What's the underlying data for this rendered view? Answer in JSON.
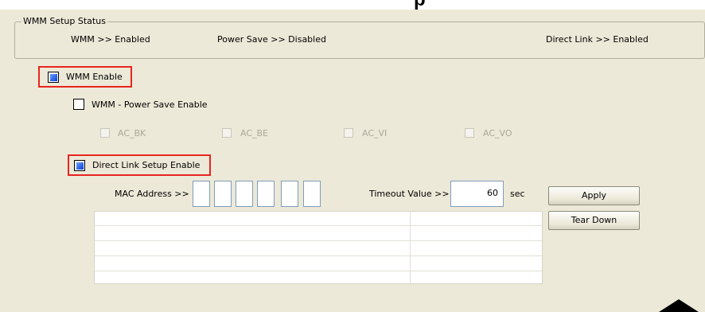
{
  "header_fragment": "p",
  "wmm_status": {
    "title": "WMM Setup Status",
    "wmm": "WMM >> Enabled",
    "power_save": "Power Save >> Disabled",
    "direct_link": "Direct Link >> Enabled"
  },
  "wmm_enable": {
    "label": "WMM Enable",
    "checked": true
  },
  "power_save_enable": {
    "label": "WMM - Power Save Enable",
    "checked": false
  },
  "ac": [
    {
      "label": "AC_BK",
      "checked": false,
      "disabled": true
    },
    {
      "label": "AC_BE",
      "checked": false,
      "disabled": true
    },
    {
      "label": "AC_VI",
      "checked": false,
      "disabled": true
    },
    {
      "label": "AC_VO",
      "checked": false,
      "disabled": true
    }
  ],
  "direct_link_enable": {
    "label": "Direct Link Setup Enable",
    "checked": true
  },
  "mac_address": {
    "label": "MAC Address >>",
    "octets": [
      "",
      "",
      "",
      "",
      "",
      ""
    ]
  },
  "timeout": {
    "label": "Timeout Value >>",
    "value": "60",
    "unit": "sec"
  },
  "buttons": {
    "apply": "Apply",
    "tear_down": "Tear Down"
  },
  "colors": {
    "highlight_border": "#e8251f",
    "dialog_bg": "#ece9d8",
    "checkbox_fill": "#0b3fd6"
  }
}
